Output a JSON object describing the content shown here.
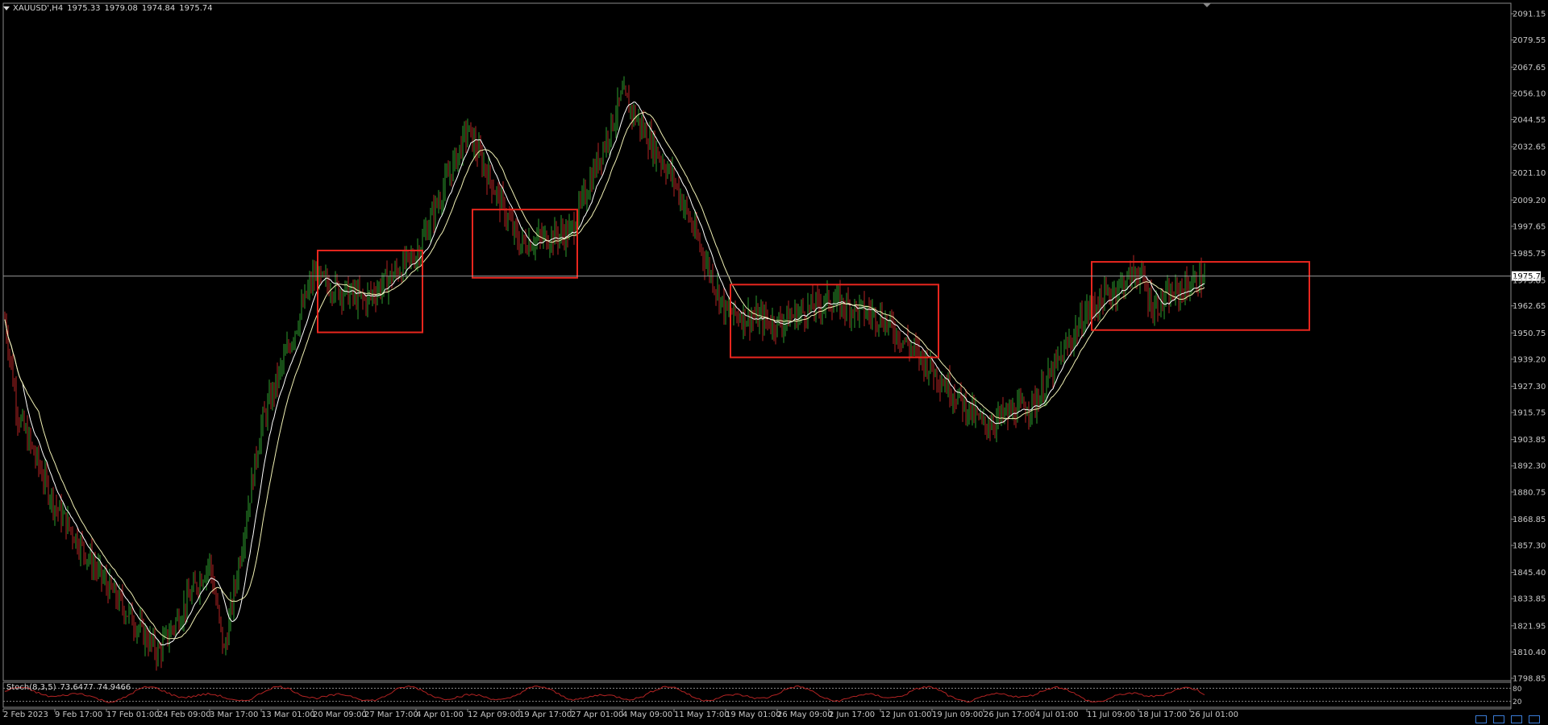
{
  "header": {
    "symbol": "XAUUSD',H4",
    "open": "1975.33",
    "high": "1979.08",
    "low": "1974.84",
    "close": "1975.74"
  },
  "price_axis": {
    "ticks": [
      "2091.15",
      "2079.55",
      "2067.65",
      "2056.10",
      "2044.55",
      "2032.65",
      "2021.10",
      "2009.20",
      "1997.65",
      "1985.75",
      "1973.85",
      "1962.65",
      "1950.75",
      "1939.20",
      "1927.30",
      "1915.75",
      "1903.85",
      "1892.30",
      "1880.75",
      "1868.85",
      "1857.30",
      "1845.40",
      "1833.85",
      "1821.95",
      "1810.40",
      "1798.85"
    ],
    "current_price_label": "1975.74"
  },
  "time_axis": {
    "ticks": [
      "2 Feb 2023",
      "9 Feb 17:00",
      "17 Feb 01:00",
      "24 Feb 09:00",
      "3 Mar 17:00",
      "13 Mar 01:00",
      "20 Mar 09:00",
      "27 Mar 17:00",
      "4 Apr 01:00",
      "12 Apr 09:00",
      "19 Apr 17:00",
      "27 Apr 01:00",
      "4 May 09:00",
      "11 May 17:00",
      "19 May 01:00",
      "26 May 09:00",
      "2 Jun 17:00",
      "12 Jun 01:00",
      "19 Jun 09:00",
      "26 Jun 17:00",
      "4 Jul 01:00",
      "11 Jul 09:00",
      "18 Jul 17:00",
      "26 Jul 01:00"
    ]
  },
  "stochastic": {
    "label": "Stoch(8,3,5)",
    "main": "73.6477",
    "signal": "74.9466",
    "levels_labels": [
      "80",
      "20"
    ]
  },
  "colors": {
    "background": "#000000",
    "bull": "#2e9b2e",
    "bear": "#b42323",
    "ma_fast": "#ffffff",
    "ma_slow": "#f0f0b4",
    "range_box": "#e8261e",
    "stoch_main": "#b42323",
    "grid_text": "#c8c8c8"
  },
  "chart_data": {
    "type": "candlestick",
    "symbol": "XAUUSD",
    "timeframe": "H4",
    "ylim": [
      1798.85,
      2091.15
    ],
    "price_path_anchors": [
      {
        "x": "2 Feb 2023",
        "price": 1962
      },
      {
        "x": "2 Feb 2023",
        "price": 1915
      },
      {
        "x": "9 Feb 17:00",
        "price": 1875
      },
      {
        "x": "17 Feb 01:00",
        "price": 1840
      },
      {
        "x": "24 Feb 09:00",
        "price": 1810
      },
      {
        "x": "3 Mar 17:00",
        "price": 1850
      },
      {
        "x": "3 Mar 17:00",
        "price": 1810
      },
      {
        "x": "13 Mar 01:00",
        "price": 1910
      },
      {
        "x": "20 Mar 09:00",
        "price": 1975
      },
      {
        "x": "27 Mar 17:00",
        "price": 1965
      },
      {
        "x": "4 Apr 01:00",
        "price": 1985
      },
      {
        "x": "12 Apr 09:00",
        "price": 2040
      },
      {
        "x": "19 Apr 17:00",
        "price": 1990
      },
      {
        "x": "27 Apr 01:00",
        "price": 1995
      },
      {
        "x": "4 May 09:00",
        "price": 2055
      },
      {
        "x": "11 May 17:00",
        "price": 2018
      },
      {
        "x": "19 May 01:00",
        "price": 1960
      },
      {
        "x": "26 May 09:00",
        "price": 1955
      },
      {
        "x": "2 Jun 17:00",
        "price": 1965
      },
      {
        "x": "12 Jun 01:00",
        "price": 1958
      },
      {
        "x": "19 Jun 09:00",
        "price": 1935
      },
      {
        "x": "26 Jun 17:00",
        "price": 1910
      },
      {
        "x": "4 Jul 01:00",
        "price": 1920
      },
      {
        "x": "11 Jul 09:00",
        "price": 1960
      },
      {
        "x": "18 Jul 17:00",
        "price": 1978
      },
      {
        "x": "18 Jul 17:00",
        "price": 1962
      },
      {
        "x": "26 Jul 01:00",
        "price": 1975.74
      }
    ],
    "moving_averages": [
      "fast",
      "slow"
    ],
    "range_boxes": [
      {
        "from": "20 Mar 09:00",
        "to": "4 Apr 01:00",
        "top": 1987,
        "bottom": 1951
      },
      {
        "from": "12 Apr 09:00",
        "to": "27 Apr 01:00",
        "top": 2005,
        "bottom": 1975
      },
      {
        "from": "19 May 01:00",
        "to": "19 Jun 09:00",
        "top": 1972,
        "bottom": 1940
      },
      {
        "from": "11 Jul 09:00",
        "to": "26 Jul 01:00",
        "top": 1982,
        "bottom": 1952
      }
    ],
    "horizontal_line": 1975.74
  }
}
